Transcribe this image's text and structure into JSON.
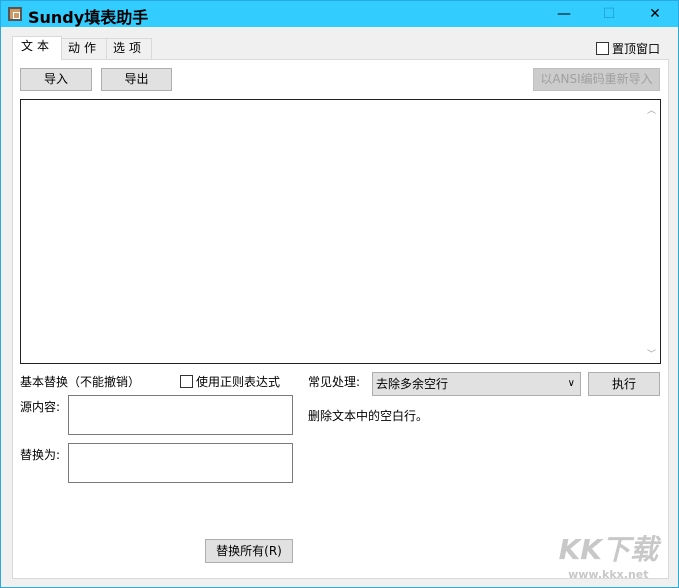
{
  "window": {
    "title": "Sundy填表助手",
    "minimize": "—",
    "maximize": "☐",
    "close": "✕"
  },
  "tabs": [
    {
      "label": "文本"
    },
    {
      "label": "动作"
    },
    {
      "label": "选项"
    }
  ],
  "topmost": {
    "label": "置顶窗口",
    "checked": false
  },
  "toolbar": {
    "import": "导入",
    "export": "导出",
    "reimport_ansi": "以ANSI编码重新导入"
  },
  "editor": {
    "value": ""
  },
  "replace": {
    "heading": "基本替换（不能撤销）",
    "regex_label": "使用正则表达式",
    "regex_checked": false,
    "source_label": "源内容:",
    "source_value": "",
    "target_label": "替换为:",
    "target_value": "",
    "replace_all": "替换所有(R)"
  },
  "common": {
    "label": "常见处理:",
    "selected": "去除多余空行",
    "execute": "执行",
    "description": "删除文本中的空白行。"
  },
  "watermark": {
    "logo": "KK下载",
    "url": "www.kkx.net"
  }
}
